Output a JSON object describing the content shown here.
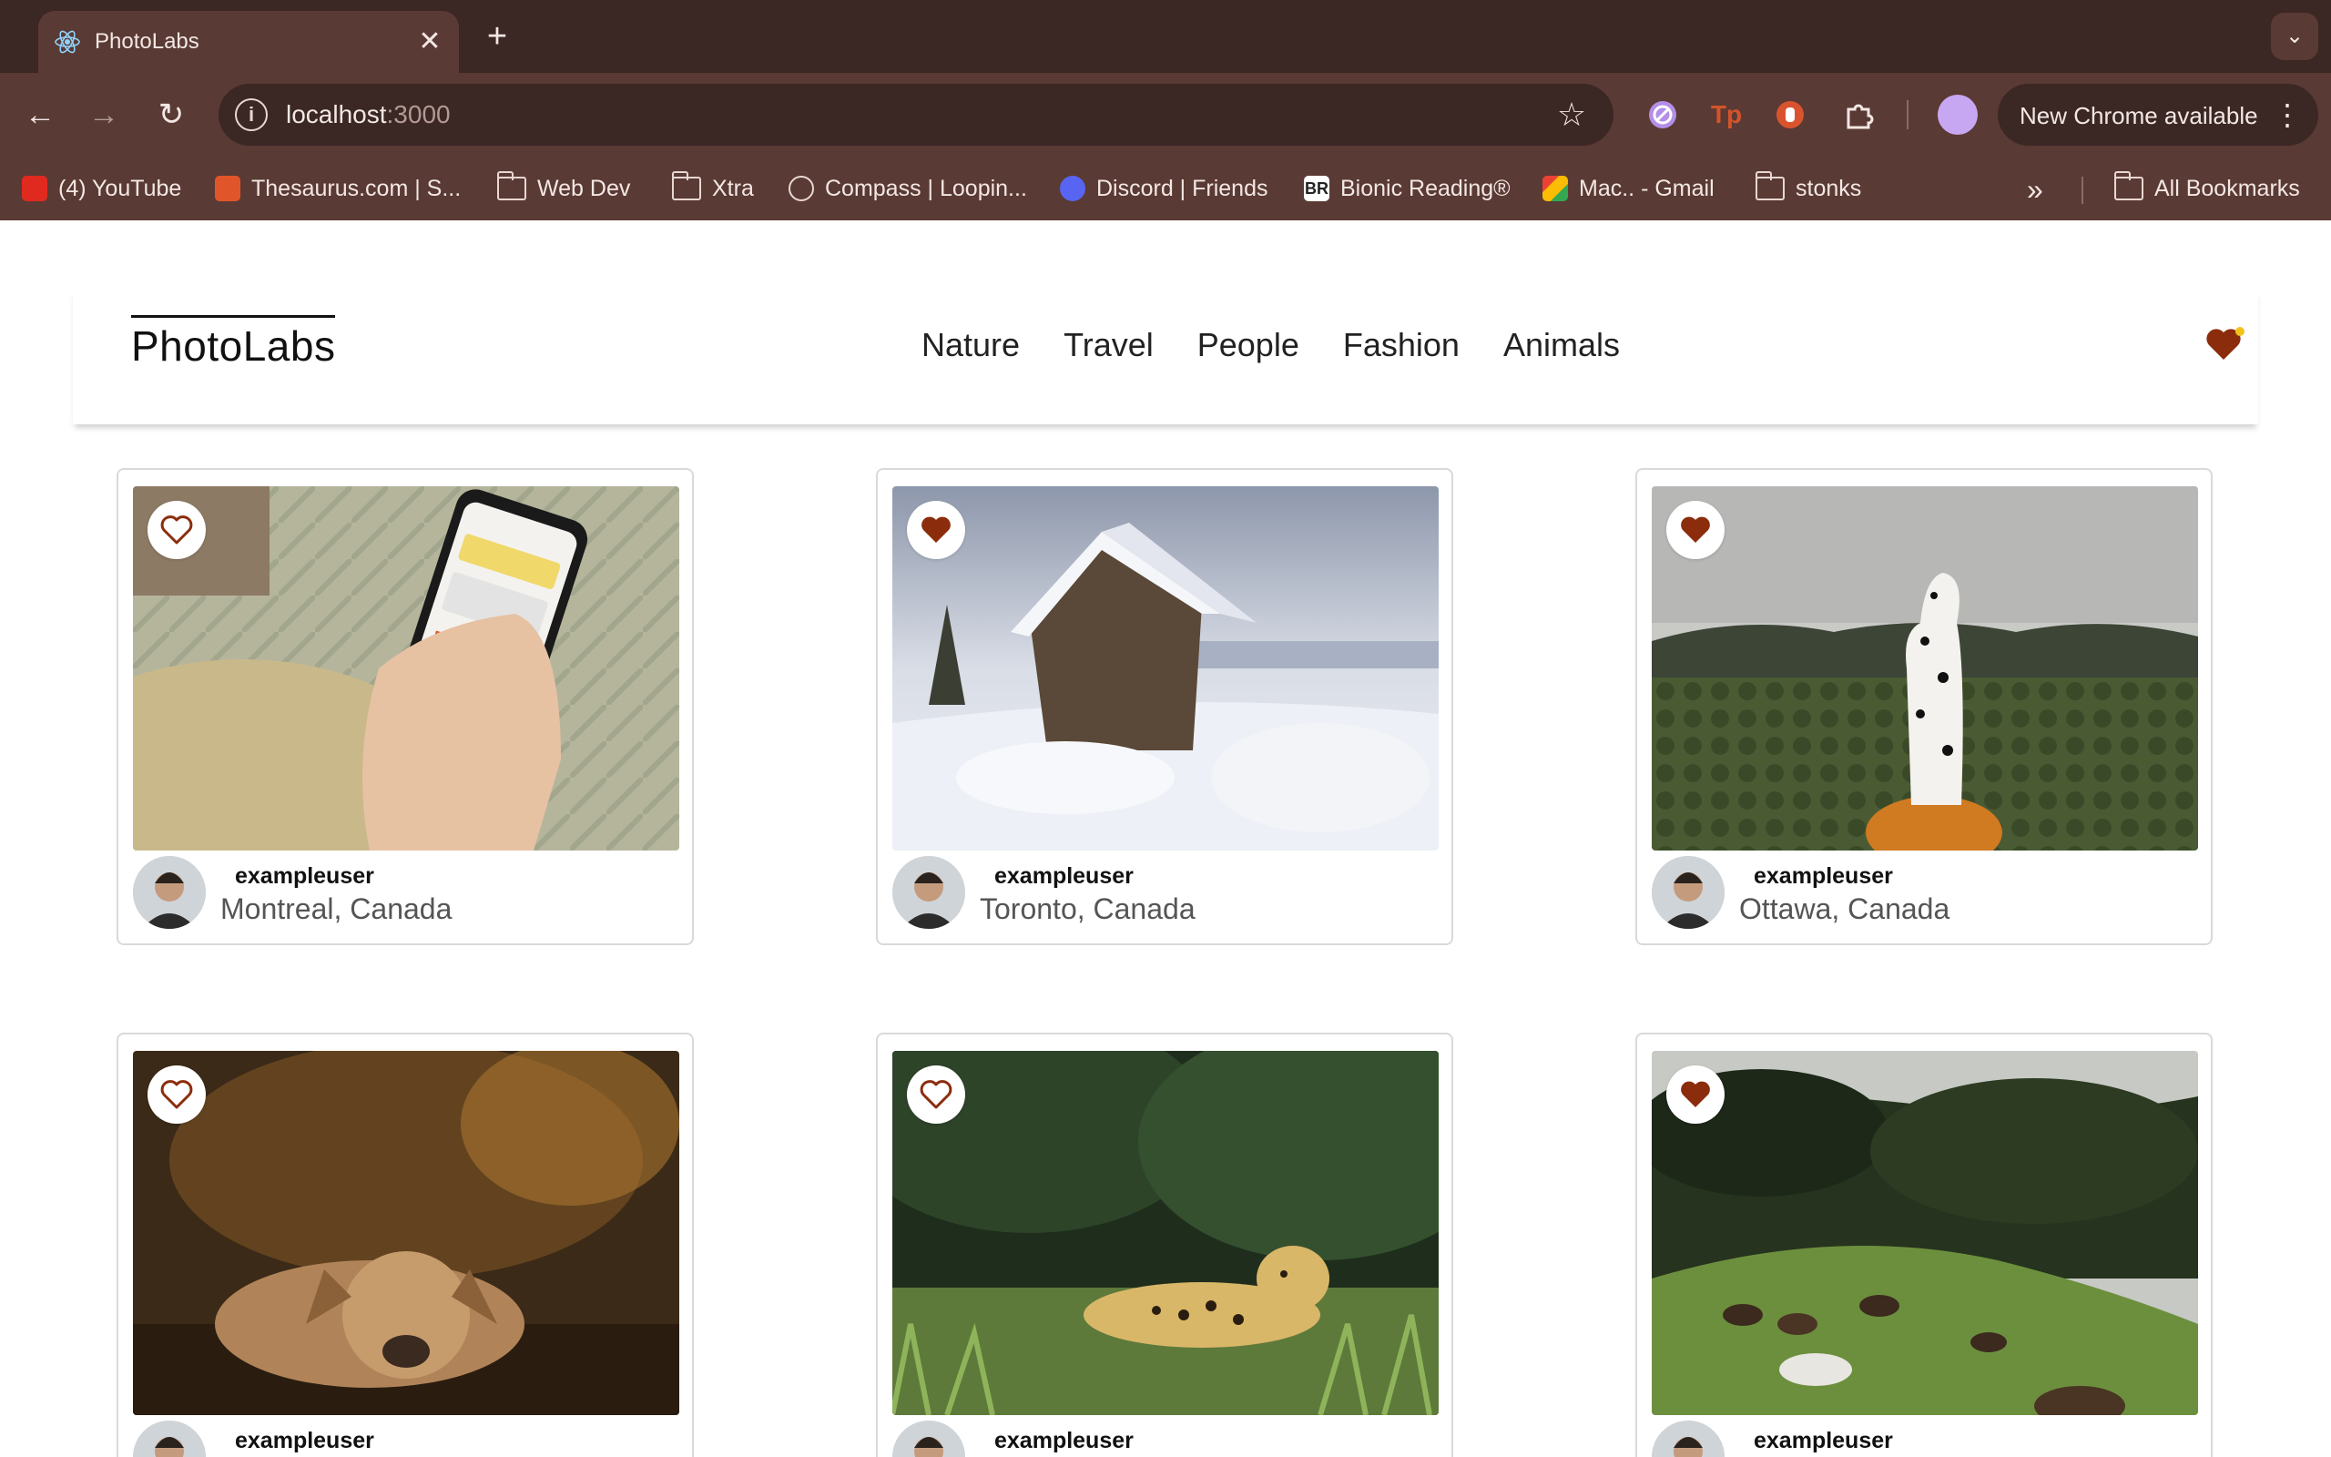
{
  "browser": {
    "tab_title": "PhotoLabs",
    "url_host": "localhost",
    "url_port": ":3000",
    "update_label": "New Chrome available",
    "bookmarks": [
      {
        "label": "(4) YouTube",
        "icon": "youtube-icon"
      },
      {
        "label": "Thesaurus.com | S...",
        "icon": "thesaurus-icon"
      },
      {
        "label": "Web Dev",
        "icon": "folder-icon"
      },
      {
        "label": "Xtra",
        "icon": "folder-icon"
      },
      {
        "label": "Compass | Loopin...",
        "icon": "compass-icon"
      },
      {
        "label": "Discord | Friends",
        "icon": "discord-icon"
      },
      {
        "label": "Bionic Reading®",
        "icon": "bionic-reading-icon"
      },
      {
        "label": "Mac.. - Gmail",
        "icon": "gmail-icon"
      },
      {
        "label": "stonks",
        "icon": "folder-icon"
      }
    ],
    "all_bookmarks_label": "All Bookmarks"
  },
  "app": {
    "logo": "PhotoLabs",
    "topics": [
      "Nature",
      "Travel",
      "People",
      "Fashion",
      "Animals"
    ],
    "accent_color": "#8b2d0c"
  },
  "photos": [
    {
      "username": "exampleuser",
      "location": "Montreal, Canada",
      "favourited": false,
      "subject": "phone-in-hand"
    },
    {
      "username": "exampleuser",
      "location": "Toronto, Canada",
      "favourited": true,
      "subject": "snowy-cabin"
    },
    {
      "username": "exampleuser",
      "location": "Ottawa, Canada",
      "favourited": true,
      "subject": "dalmatian-on-pumpkin"
    },
    {
      "username": "exampleuser",
      "location": "",
      "favourited": false,
      "subject": "dog-in-forest"
    },
    {
      "username": "exampleuser",
      "location": "",
      "favourited": false,
      "subject": "jaguar-in-grass"
    },
    {
      "username": "exampleuser",
      "location": "",
      "favourited": true,
      "subject": "horses-on-hill"
    }
  ]
}
